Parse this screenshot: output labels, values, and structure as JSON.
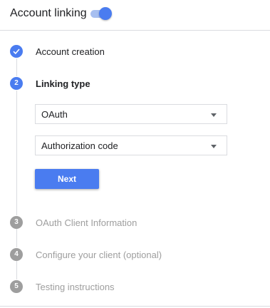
{
  "header": {
    "title": "Account linking",
    "toggle_on": true,
    "toggle_color": "#4a7cf0"
  },
  "steps": [
    {
      "number": "1",
      "label": "Account creation",
      "state": "completed",
      "icon": "check-icon"
    },
    {
      "number": "2",
      "label": "Linking type",
      "state": "current"
    },
    {
      "number": "3",
      "label": "OAuth Client Information",
      "state": "upcoming"
    },
    {
      "number": "4",
      "label": "Configure your client (optional)",
      "state": "upcoming"
    },
    {
      "number": "5",
      "label": "Testing instructions",
      "state": "upcoming"
    }
  ],
  "linking_type": {
    "type_select": {
      "value": "OAuth",
      "icon": "dropdown-caret-icon"
    },
    "grant_select": {
      "value": "Authorization code",
      "icon": "dropdown-caret-icon"
    },
    "next_label": "Next"
  },
  "colors": {
    "accent": "#4a7cf0",
    "inactive": "#9e9e9e",
    "divider": "#dadce0"
  }
}
